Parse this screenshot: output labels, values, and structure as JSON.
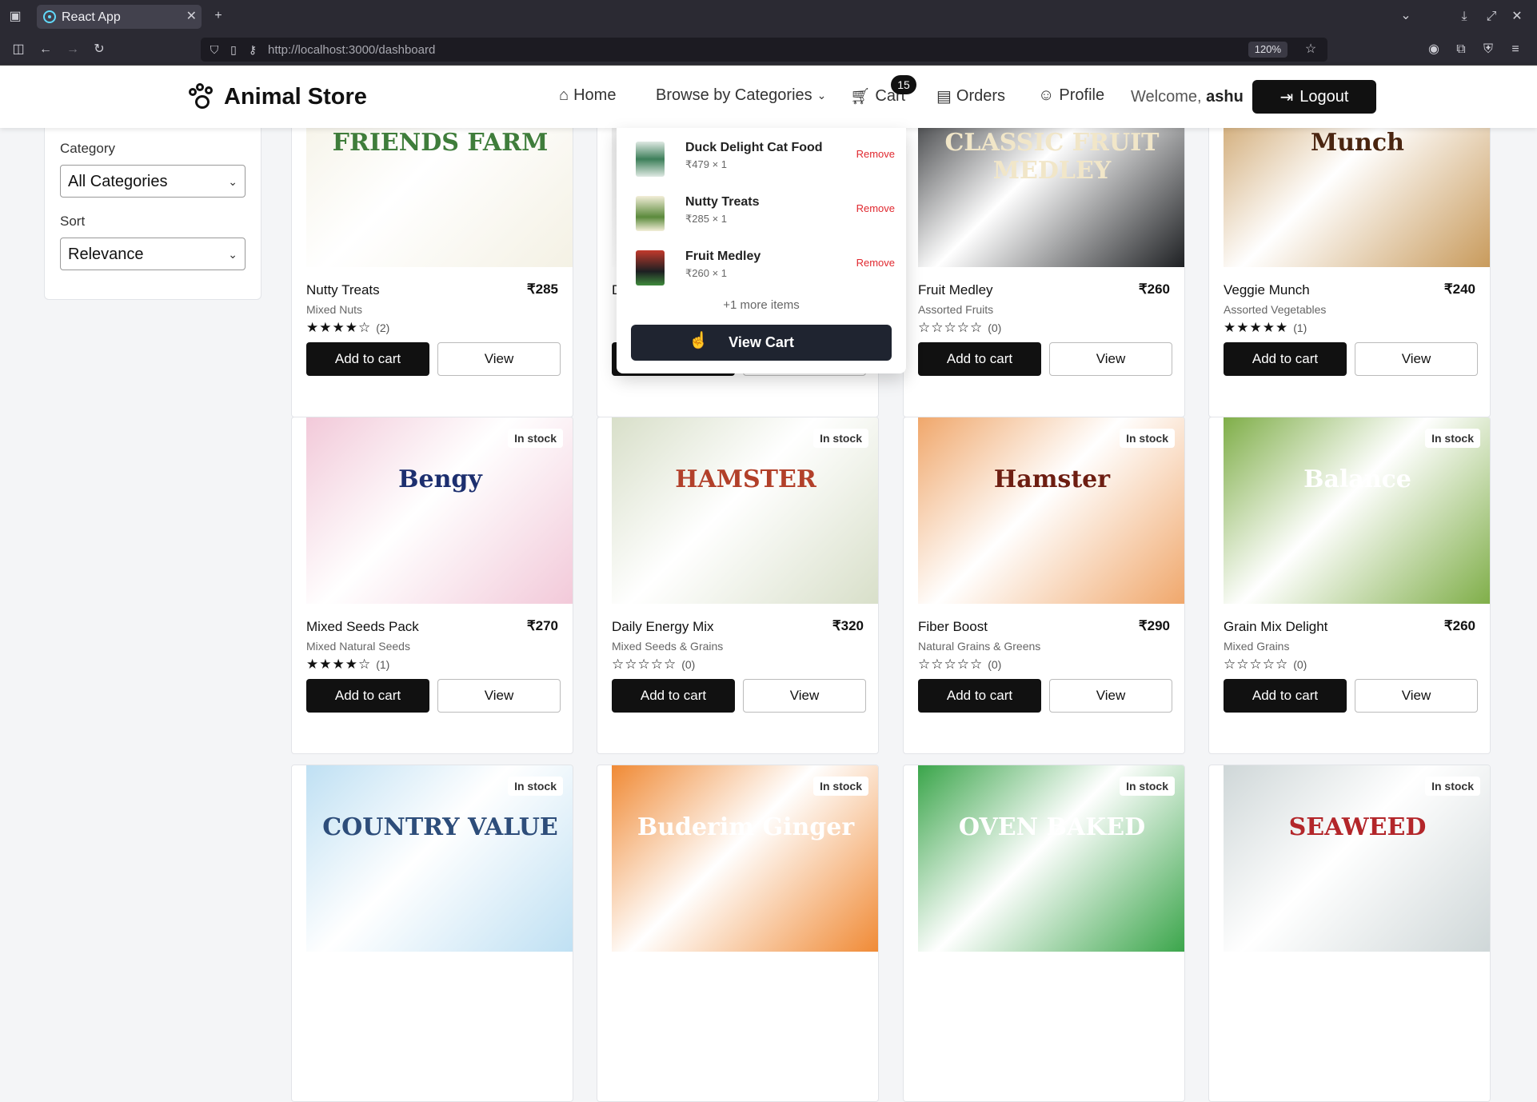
{
  "browser": {
    "tab_title": "React App",
    "url": "http://localhost:3000/dashboard",
    "zoom": "120%"
  },
  "header": {
    "brand": "Animal Store",
    "nav": {
      "home": "Home",
      "categories": "Browse by Categories",
      "cart": "Cart",
      "cart_count": "15",
      "orders": "Orders",
      "profile": "Profile"
    },
    "welcome_prefix": "Welcome,",
    "username": "ashu",
    "logout": "Logout"
  },
  "filters": {
    "category_label": "Category",
    "category_value": "All Categories",
    "sort_label": "Sort",
    "sort_value": "Relevance"
  },
  "cart_dropdown": {
    "items": [
      {
        "name": "Duck Delight Cat Food",
        "qty": "₹479 × 1",
        "remove": "Remove"
      },
      {
        "name": "Nutty Treats",
        "qty": "₹285 × 1",
        "remove": "Remove"
      },
      {
        "name": "Fruit Medley",
        "qty": "₹260 × 1",
        "remove": "Remove"
      }
    ],
    "more": "+1 more items",
    "view_cart": "View Cart"
  },
  "products": [
    {
      "name": "Nutty Treats",
      "price": "₹285",
      "category": "Mixed Nuts",
      "stars": "★★★★☆",
      "count": "(2)",
      "add": "Add to cart",
      "view": "View",
      "badge": "",
      "image_text": "FRIENDS FARM",
      "image_bg": "#f4f1e4",
      "image_fg": "#3f7d3b"
    },
    {
      "name": "Duck Delight Cat Food",
      "price": "",
      "category": "",
      "stars": "",
      "count": "",
      "add": "Add to cart",
      "view": "View",
      "badge": "",
      "image_text": "",
      "image_bg": "#e9e9e9",
      "image_fg": "#555555"
    },
    {
      "name": "Fruit Medley",
      "price": "₹260",
      "category": "Assorted Fruits",
      "stars": "☆☆☆☆☆",
      "count": "(0)",
      "add": "Add to cart",
      "view": "View",
      "badge": "",
      "image_text": "CLASSIC FRUIT MEDLEY",
      "image_bg": "#1d1f22",
      "image_fg": "#f1e6c8"
    },
    {
      "name": "Veggie Munch",
      "price": "₹240",
      "category": "Assorted Vegetables",
      "stars": "★★★★★",
      "count": "(1)",
      "add": "Add to cart",
      "view": "View",
      "badge": "",
      "image_text": "Munch",
      "image_bg": "#c89a5b",
      "image_fg": "#4a2510"
    },
    {
      "name": "Mixed Seeds Pack",
      "price": "₹270",
      "category": "Mixed Natural Seeds",
      "stars": "★★★★☆",
      "count": "(1)",
      "add": "Add to cart",
      "view": "View",
      "badge": "In stock",
      "image_text": "Bengy",
      "image_bg": "#f2c9d9",
      "image_fg": "#1d2f6f"
    },
    {
      "name": "Daily Energy Mix",
      "price": "₹320",
      "category": "Mixed Seeds & Grains",
      "stars": "☆☆☆☆☆",
      "count": "(0)",
      "add": "Add to cart",
      "view": "View",
      "badge": "In stock",
      "image_text": "HAMSTER",
      "image_bg": "#d8dfc9",
      "image_fg": "#b2402a"
    },
    {
      "name": "Fiber Boost",
      "price": "₹290",
      "category": "Natural Grains & Greens",
      "stars": "☆☆☆☆☆",
      "count": "(0)",
      "add": "Add to cart",
      "view": "View",
      "badge": "In stock",
      "image_text": "Hamster",
      "image_bg": "#f0a76b",
      "image_fg": "#6e1e12"
    },
    {
      "name": "Grain Mix Delight",
      "price": "₹260",
      "category": "Mixed Grains",
      "stars": "☆☆☆☆☆",
      "count": "(0)",
      "add": "Add to cart",
      "view": "View",
      "badge": "In stock",
      "image_text": "Balance",
      "image_bg": "#7fae48",
      "image_fg": "#ffffff"
    },
    {
      "name": "",
      "price": "",
      "category": "",
      "stars": "",
      "count": "",
      "add": "",
      "view": "",
      "badge": "In stock",
      "image_text": "COUNTRY VALUE",
      "image_bg": "#bfe0f3",
      "image_fg": "#2d4d7a"
    },
    {
      "name": "",
      "price": "",
      "category": "",
      "stars": "",
      "count": "",
      "add": "",
      "view": "",
      "badge": "In stock",
      "image_text": "Buderim Ginger",
      "image_bg": "#f08a35",
      "image_fg": "#ffffff"
    },
    {
      "name": "",
      "price": "",
      "category": "",
      "stars": "",
      "count": "",
      "add": "",
      "view": "",
      "badge": "In stock",
      "image_text": "OVEN BAKED",
      "image_bg": "#3aa54a",
      "image_fg": "#ffffff"
    },
    {
      "name": "",
      "price": "",
      "category": "",
      "stars": "",
      "count": "",
      "add": "",
      "view": "",
      "badge": "In stock",
      "image_text": "SEAWEED",
      "image_bg": "#cfd7d8",
      "image_fg": "#b3262a"
    }
  ],
  "colors": {
    "accent": "#111111",
    "remove": "#e0282f",
    "view_cart_bg": "#1f2430"
  }
}
